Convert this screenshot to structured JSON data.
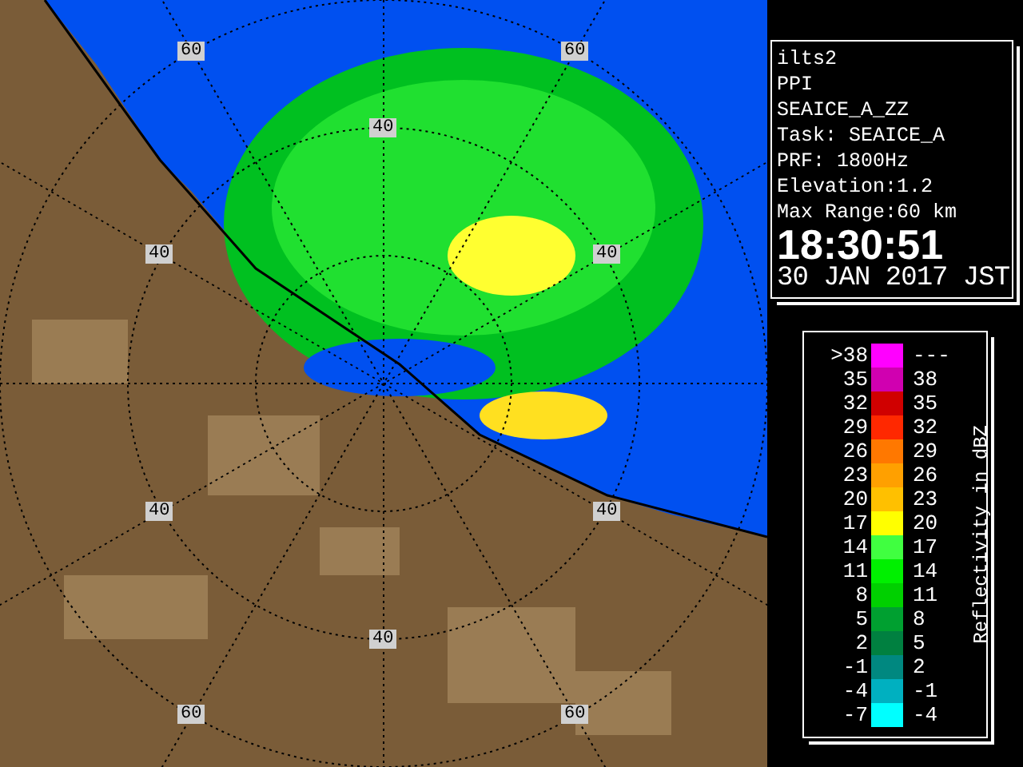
{
  "radar_map": {
    "range_labels": [
      "60",
      "60",
      "40",
      "40",
      "40",
      "40",
      "40",
      "40",
      "60",
      "60"
    ]
  },
  "info_panel": {
    "lines": [
      "ilts2",
      "PPI",
      "SEAICE_A_ZZ",
      "Task: SEAICE_A",
      "PRF: 1800Hz",
      "Elevation:1.2",
      "Max Range:60 km"
    ],
    "time": "18:30:51",
    "date": "30 JAN 2017 JST"
  },
  "legend": {
    "axis_title": "Reflectivity in dBZ",
    "bins": [
      {
        "low": ">38",
        "high": "---",
        "color": "#ff00ff"
      },
      {
        "low": "35",
        "high": "38",
        "color": "#d000b0"
      },
      {
        "low": "32",
        "high": "35",
        "color": "#d00000"
      },
      {
        "low": "29",
        "high": "32",
        "color": "#ff2800"
      },
      {
        "low": "26",
        "high": "29",
        "color": "#ff7800"
      },
      {
        "low": "23",
        "high": "26",
        "color": "#ffa000"
      },
      {
        "low": "20",
        "high": "23",
        "color": "#ffc000"
      },
      {
        "low": "17",
        "high": "20",
        "color": "#ffff00"
      },
      {
        "low": "14",
        "high": "17",
        "color": "#40ff40"
      },
      {
        "low": "11",
        "high": "14",
        "color": "#00f000"
      },
      {
        "low": "8",
        "high": "11",
        "color": "#00d000"
      },
      {
        "low": "5",
        "high": "8",
        "color": "#00a030"
      },
      {
        "low": "2",
        "high": "5",
        "color": "#008040"
      },
      {
        "low": "-1",
        "high": "2",
        "color": "#008880"
      },
      {
        "low": "-4",
        "high": "-1",
        "color": "#00b0c0"
      },
      {
        "low": "-7",
        "high": "-4",
        "color": "#00ffff"
      }
    ]
  }
}
